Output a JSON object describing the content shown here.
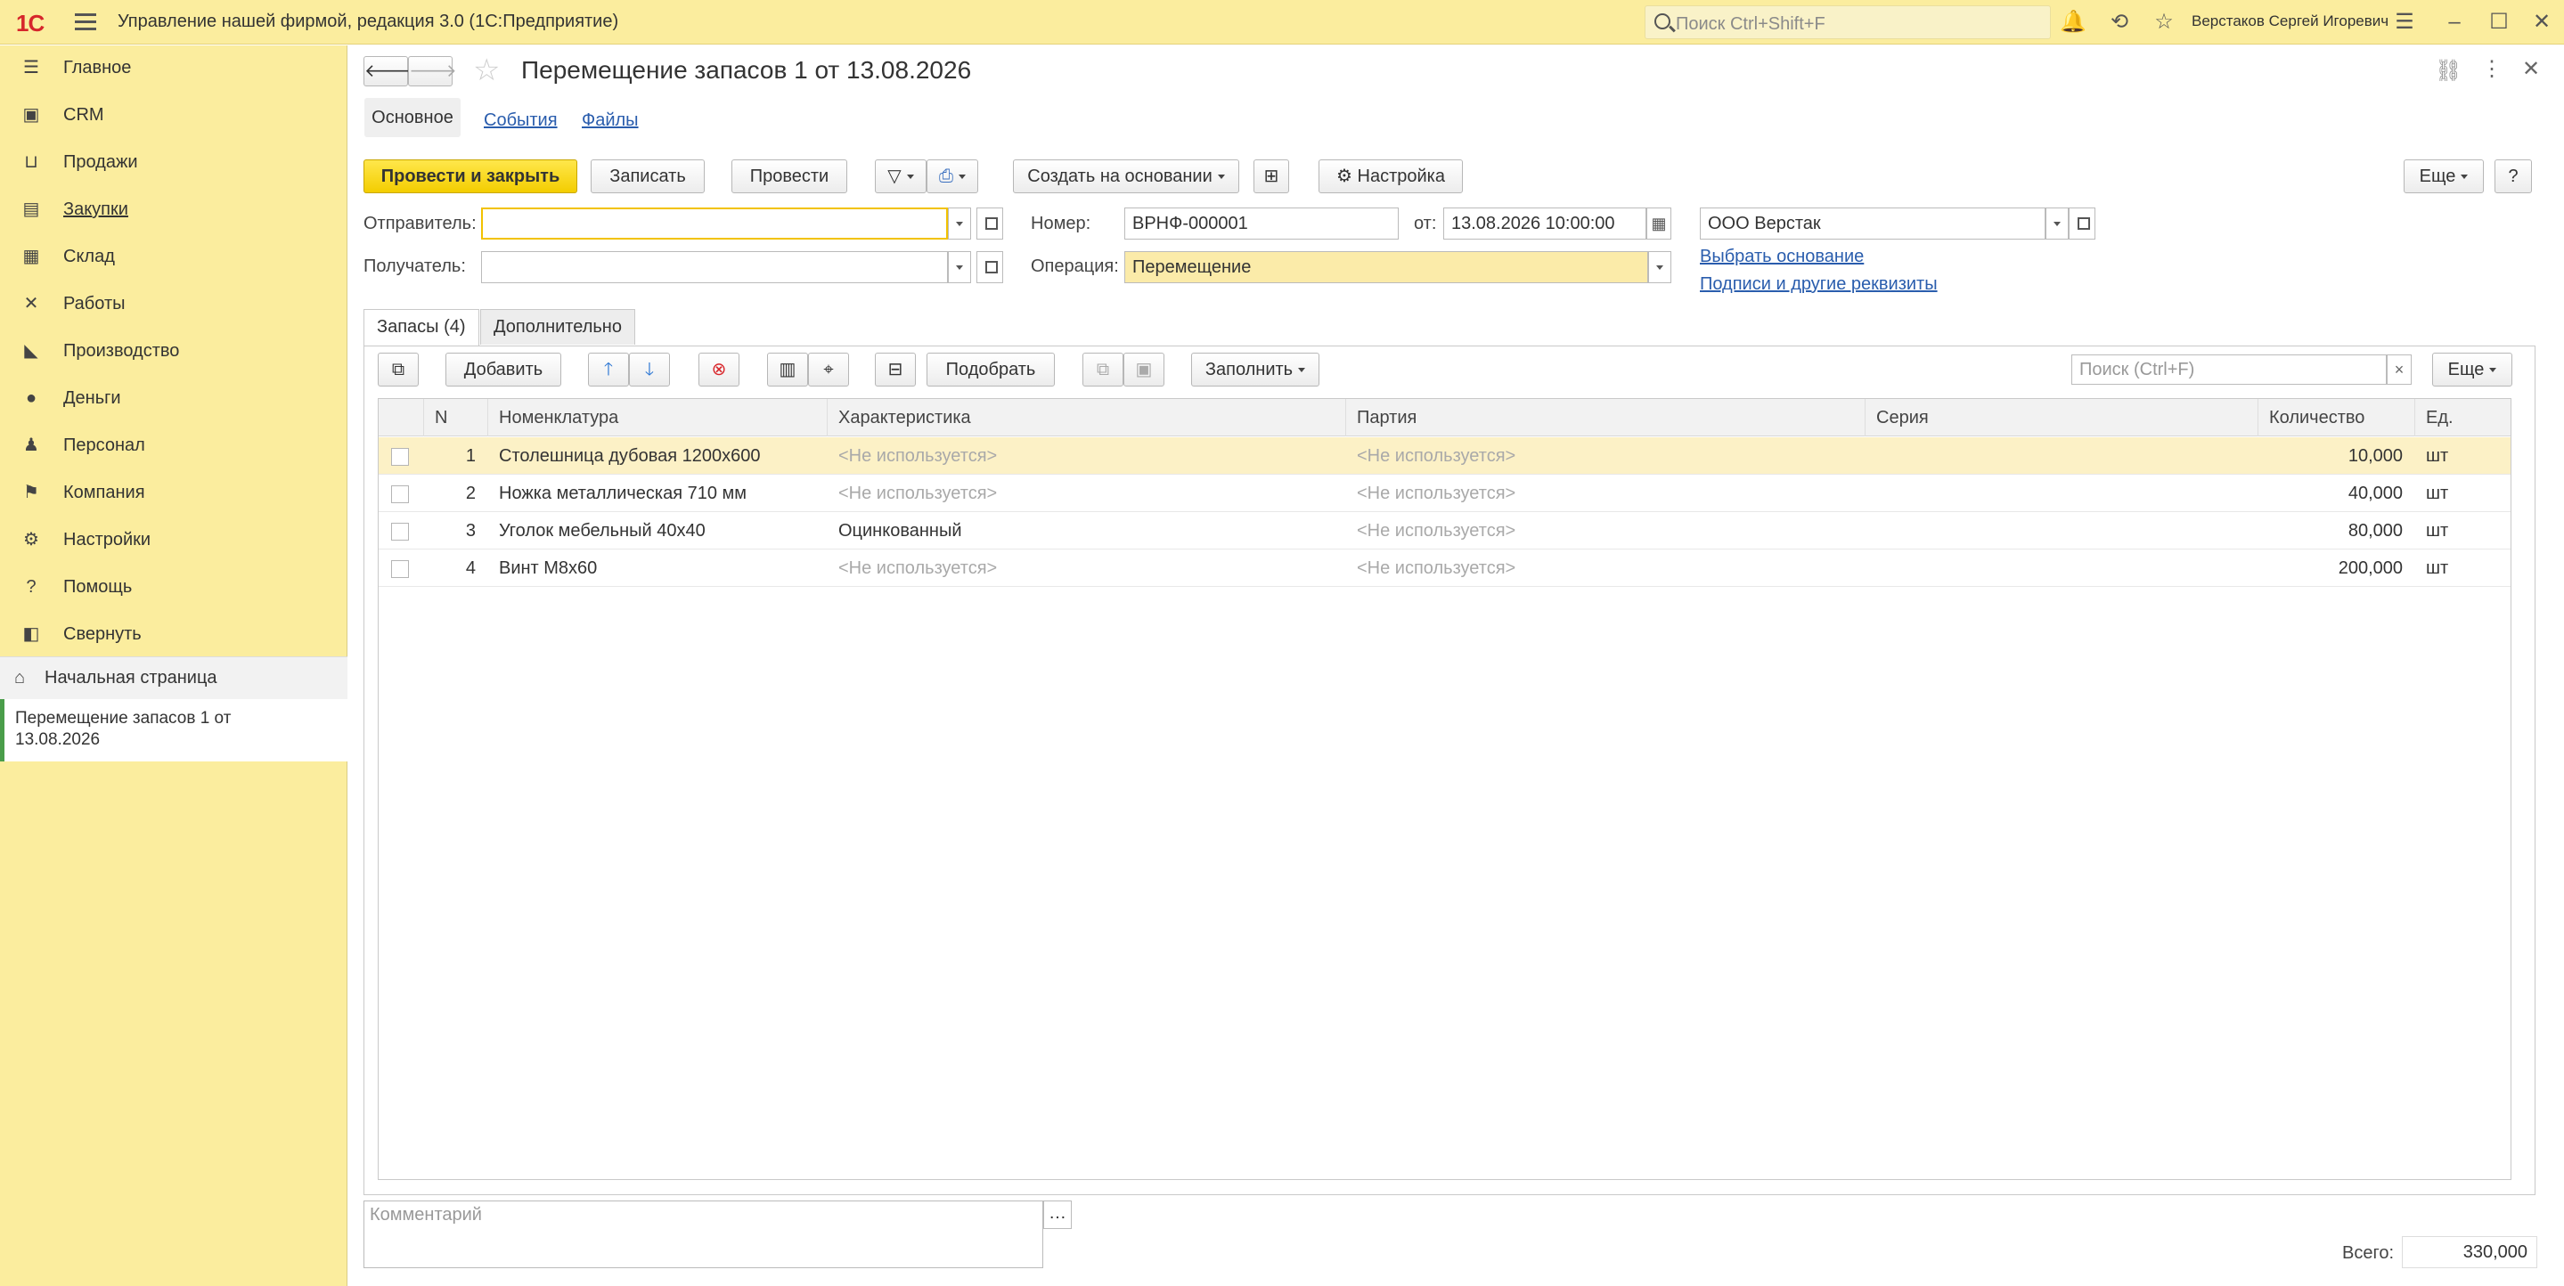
{
  "titlebar": {
    "logo": "1С",
    "app_title": "Управление нашей фирмой, редакция 3.0  (1С:Предприятие)",
    "search_placeholder": "Поиск Ctrl+Shift+F",
    "user": "Верстаков Сергей Игоревич"
  },
  "sidebar": {
    "items": [
      {
        "label": "Главное",
        "icon": "list-icon"
      },
      {
        "label": "CRM",
        "icon": "crm-icon"
      },
      {
        "label": "Продажи",
        "icon": "basket-icon"
      },
      {
        "label": "Закупки",
        "icon": "purchases-icon"
      },
      {
        "label": "Склад",
        "icon": "warehouse-icon"
      },
      {
        "label": "Работы",
        "icon": "tools-icon"
      },
      {
        "label": "Производство",
        "icon": "factory-icon"
      },
      {
        "label": "Деньги",
        "icon": "money-icon"
      },
      {
        "label": "Персонал",
        "icon": "people-icon"
      },
      {
        "label": "Компания",
        "icon": "flag-icon"
      },
      {
        "label": "Настройки",
        "icon": "gear-icon"
      },
      {
        "label": "Помощь",
        "icon": "help-icon"
      },
      {
        "label": "Свернуть",
        "icon": "collapse-icon"
      }
    ],
    "home": "Начальная страница",
    "current": "Перемещение запасов 1 от 13.08.2026"
  },
  "doc": {
    "title": "Перемещение запасов 1 от 13.08.2026",
    "tabs": [
      "Основное",
      "События",
      "Файлы"
    ],
    "toolbar": {
      "post_close": "Провести и закрыть",
      "save": "Записать",
      "post": "Провести",
      "create_based": "Создать на основании",
      "settings": "Настройка",
      "more": "Еще",
      "help": "?"
    },
    "form": {
      "sender_label": "Отправитель:",
      "sender_value": "",
      "receiver_label": "Получатель:",
      "receiver_value": "",
      "number_label": "Номер:",
      "number_value": "ВРНФ-000001",
      "date_label": "от:",
      "date_value": "13.08.2026 10:00:00",
      "operation_label": "Операция:",
      "operation_value": "Перемещение",
      "company_value": "ООО Верстак",
      "basis_link": "Выбрать основание",
      "signatures_link": "Подписи и другие реквизиты"
    },
    "subtabs": [
      "Запасы (4)",
      "Дополнительно"
    ],
    "table_toolbar": {
      "add": "Добавить",
      "pick": "Подобрать",
      "fill": "Заполнить",
      "search_placeholder": "Поиск (Ctrl+F)",
      "more": "Еще"
    },
    "columns": [
      "N",
      "Номенклатура",
      "Характеристика",
      "Партия",
      "Серия",
      "Количество",
      "Ед."
    ],
    "rows": [
      {
        "n": "1",
        "item": "Столешница дубовая 1200х600",
        "char": "<Не используется>",
        "batch": "<Не используется>",
        "series": "",
        "qty": "10,000",
        "unit": "шт"
      },
      {
        "n": "2",
        "item": "Ножка металлическая 710 мм",
        "char": "<Не используется>",
        "batch": "<Не используется>",
        "series": "",
        "qty": "40,000",
        "unit": "шт"
      },
      {
        "n": "3",
        "item": "Уголок мебельный 40х40",
        "char": "Оцинкованный",
        "batch": "<Не используется>",
        "series": "",
        "qty": "80,000",
        "unit": "шт"
      },
      {
        "n": "4",
        "item": "Винт М8х60",
        "char": "<Не используется>",
        "batch": "<Не используется>",
        "series": "",
        "qty": "200,000",
        "unit": "шт"
      }
    ],
    "comment_placeholder": "Комментарий",
    "total_label": "Всего:",
    "total_value": "330,000"
  },
  "colors": {
    "accent": "#fbed9e",
    "primary_button": "#f3cd00",
    "link": "#2a5dad",
    "selected_row": "#fcf1c6"
  }
}
